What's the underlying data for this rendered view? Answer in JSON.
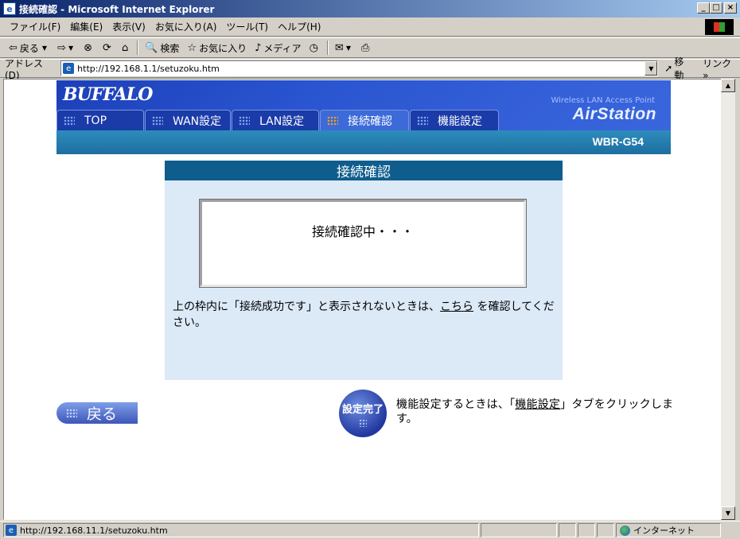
{
  "window": {
    "title": "接続確認 - Microsoft Internet Explorer",
    "min_label": "_",
    "max_label": "□",
    "close_label": "×"
  },
  "menu": [
    "ファイル(F)",
    "編集(E)",
    "表示(V)",
    "お気に入り(A)",
    "ツール(T)",
    "ヘルプ(H)"
  ],
  "toolbar": {
    "back_label": "戻る",
    "search_label": "検索",
    "favorites_label": "お気に入り",
    "media_label": "メディア"
  },
  "address": {
    "label": "アドレス(D)",
    "url": "http://192.168.1.1/setuzoku.htm",
    "go_label": "移動",
    "links_label": "リンク »"
  },
  "router": {
    "brand": "BUFFALO",
    "tagline": "Wireless LAN Access Point",
    "product": "AirStation",
    "model": "WBR-G54",
    "tabs": [
      {
        "label": "TOP",
        "active": false
      },
      {
        "label": "WAN設定",
        "active": false
      },
      {
        "label": "LAN設定",
        "active": false
      },
      {
        "label": "接続確認",
        "active": true
      },
      {
        "label": "機能設定",
        "active": false
      }
    ]
  },
  "panel": {
    "title": "接続確認",
    "status_text": "接続確認中・・・",
    "note_before": "上の枠内に「接続成功です」と表示されないときは、",
    "note_link": "こちら",
    "note_after": " を確認してください。"
  },
  "buttons": {
    "back_label": "戻る",
    "done_label": "設定完了"
  },
  "hint": {
    "before": "機能設定するときは、「",
    "link": "機能設定",
    "after": "」タブをクリックします。"
  },
  "status": {
    "url": "http://192.168.11.1/setuzoku.htm",
    "zone": "インターネット"
  },
  "colors": {
    "header_blue": "#2a55d0",
    "panel_head": "#0f5d8c",
    "panel_bg": "#dce9f7"
  }
}
